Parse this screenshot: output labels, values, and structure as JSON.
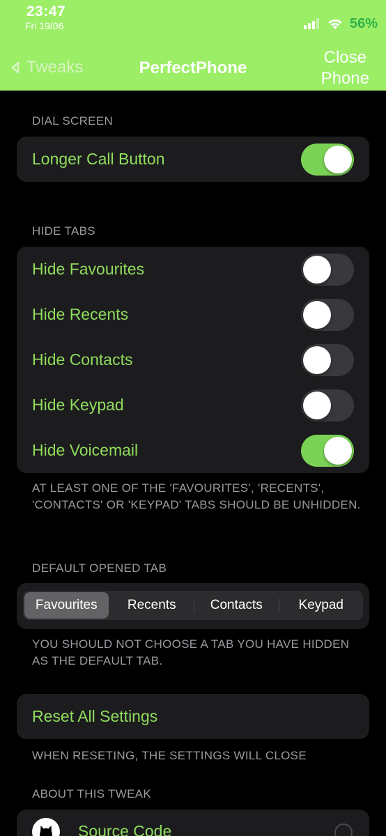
{
  "status_bar": {
    "time": "23:47",
    "date": "Fri 19/06",
    "battery": "56%"
  },
  "nav": {
    "back_label": "Tweaks",
    "title": "PerfectPhone",
    "close_line1": "Close",
    "close_line2": "Phone"
  },
  "dial_screen": {
    "header": "DIAL SCREEN",
    "rows": [
      {
        "label": "Longer Call Button",
        "on": true
      }
    ]
  },
  "hide_tabs": {
    "header": "HIDE TABS",
    "rows": [
      {
        "label": "Hide Favourites",
        "on": false
      },
      {
        "label": "Hide Recents",
        "on": false
      },
      {
        "label": "Hide Contacts",
        "on": false
      },
      {
        "label": "Hide Keypad",
        "on": false
      },
      {
        "label": "Hide Voicemail",
        "on": true
      }
    ],
    "footer": "AT LEAST ONE OF THE 'FAVOURITES', 'RECENTS', 'CONTACTS' OR 'KEYPAD' TABS SHOULD BE UNHIDDEN."
  },
  "default_tab": {
    "header": "DEFAULT OPENED TAB",
    "options": [
      "Favourites",
      "Recents",
      "Contacts",
      "Keypad"
    ],
    "selected": "Favourites",
    "footer": "YOU SHOULD NOT CHOOSE A TAB YOU HAVE HIDDEN AS THE DEFAULT TAB."
  },
  "reset": {
    "label": "Reset All Settings",
    "footer": "WHEN RESETING, THE SETTINGS WILL CLOSE"
  },
  "about": {
    "header": "ABOUT THIS TWEAK",
    "source_label": "Source Code"
  },
  "colors": {
    "header_bg": "#9bee66",
    "accent": "#8fdc5c",
    "toggle_on": "#7bd355",
    "cell_bg": "#1c1c1e"
  }
}
